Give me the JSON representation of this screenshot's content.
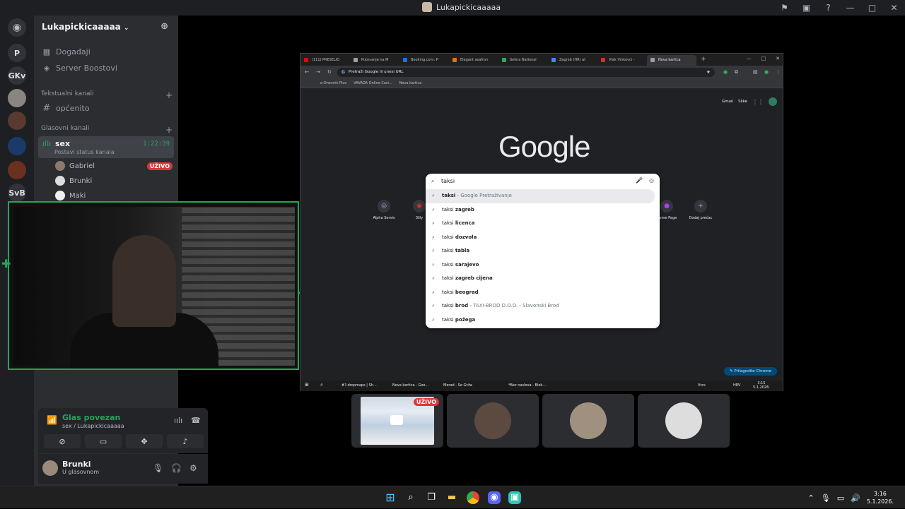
{
  "window": {
    "title": "Lukapickicaaaaa",
    "controls": [
      "⚑",
      "▣",
      "?",
      "—",
      "□",
      "✕"
    ]
  },
  "servers": [
    {
      "label": "P"
    },
    {
      "label": "GKv"
    },
    {
      "label": "SvB"
    }
  ],
  "guild": {
    "name": "Lukapickicaaaaa",
    "chevron": "⌄",
    "add_icon": "👤+",
    "items": [
      {
        "icon": "▦",
        "label": "Događaji"
      },
      {
        "icon": "◈",
        "label": "Server Boostovi"
      }
    ],
    "text_category": "Tekstualni kanali",
    "text_channels": [
      {
        "icon": "#",
        "label": "općenito"
      }
    ],
    "voice_category": "Glasovni kanali",
    "active_voice": {
      "name": "sex",
      "status": "Postavi status kanala",
      "timer": "1:22:39"
    },
    "voice_users": [
      {
        "name": "Gabriel",
        "live": "UŽIVO"
      },
      {
        "name": "Brunki"
      },
      {
        "name": "Maki"
      }
    ]
  },
  "voice_panel": {
    "title": "Glas povezan",
    "subtitle": "sex / Lukapickicaaaaa"
  },
  "user_panel": {
    "name": "Brunki",
    "status": "U glasovnom"
  },
  "browser": {
    "tabs": [
      {
        "title": "(111) PRESELIO",
        "color": "#ff0000"
      },
      {
        "title": "Putovanje na M",
        "color": "#9aa0a6"
      },
      {
        "title": "Booking.com: P",
        "color": "#1a73e8"
      },
      {
        "title": "Elegant seafron",
        "color": "#e8710a"
      },
      {
        "title": "Selina National",
        "color": "#34a853"
      },
      {
        "title": "Zagreb (HR) at",
        "color": "#4285f4"
      },
      {
        "title": "Vlak Vinkovci -",
        "color": "#d93025"
      },
      {
        "title": "Nova kartica",
        "color": "#9aa0a6"
      }
    ],
    "omnibox_placeholder": "Pretraži Google ili unesi URL",
    "bookmarks": [
      "e-Dnevnik Plus",
      "VAVADA Online Casi...",
      "Nova kartica"
    ],
    "top_links": [
      "Gmail",
      "Slike"
    ],
    "logo": "Google",
    "query": "taksi",
    "suggestions": [
      {
        "bold": "taksi",
        "extra": " - Google Pretraživanje",
        "highlight": true
      },
      {
        "base": "taksi ",
        "bold": "zagreb"
      },
      {
        "base": "taksi ",
        "bold": "licenca"
      },
      {
        "base": "taksi ",
        "bold": "dozvola"
      },
      {
        "base": "taksi ",
        "bold": "tabla"
      },
      {
        "base": "taksi ",
        "bold": "sarajevo"
      },
      {
        "base": "taksi ",
        "bold": "zagreb cijena"
      },
      {
        "base": "taksi ",
        "bold": "beograd"
      },
      {
        "base": "taksi ",
        "bold": "brod",
        "extra": " - TAXI-BROD D.O.O. - Slavonski Brod"
      },
      {
        "base": "taksi ",
        "bold": "požega"
      }
    ],
    "shortcuts": [
      {
        "label": "Alpha Servis",
        "glyph": "◎"
      },
      {
        "label": "3lily",
        "glyph": "◉"
      },
      {
        "label": "Home Page",
        "glyph": "●"
      },
      {
        "label": "Dodaj prečac",
        "glyph": "+"
      }
    ],
    "customize": "Prilagodite Chrome",
    "inner_taskbar": [
      "#?-dropmaps | Sh...",
      "Nova kartica - Goo...",
      "Merad - Se Grita",
      "*Bez naslova - Blok..."
    ],
    "inner_tray": "Vrcs",
    "inner_lang": "HRV",
    "inner_clock": {
      "time": "3:15",
      "date": "5.1.2026."
    }
  },
  "tiles": [
    {
      "type": "screen",
      "live": "UŽIVO"
    },
    {
      "type": "avatar",
      "color": "#5c4a40"
    },
    {
      "type": "avatar",
      "color": "#a09080"
    },
    {
      "type": "avatar",
      "color": "#ddd"
    }
  ],
  "os": {
    "clock": {
      "time": "3:16",
      "date": "5.1.2026."
    }
  }
}
